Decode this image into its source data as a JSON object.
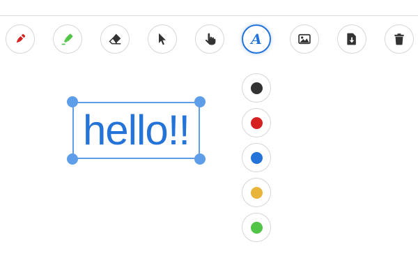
{
  "colors": {
    "accent": "#2473d8",
    "selection": "#5e9ee8",
    "icon_dark": "#333333",
    "pen_red": "#d62121",
    "highlighter_green": "#52c447"
  },
  "toolbar": {
    "tools": [
      {
        "name": "pen-tool-button",
        "icon": "pen-icon",
        "active": false
      },
      {
        "name": "highlighter-tool-button",
        "icon": "highlighter-icon",
        "active": false
      },
      {
        "name": "eraser-tool-button",
        "icon": "eraser-icon",
        "active": false
      },
      {
        "name": "select-tool-button",
        "icon": "cursor-arrow-icon",
        "active": false
      },
      {
        "name": "pan-tool-button",
        "icon": "hand-pointer-icon",
        "active": false
      },
      {
        "name": "text-tool-button",
        "icon": "text-a-icon",
        "active": true,
        "glyph": "A"
      },
      {
        "name": "image-tool-button",
        "icon": "image-icon",
        "active": false
      },
      {
        "name": "download-button",
        "icon": "file-download-icon",
        "active": false
      },
      {
        "name": "delete-button",
        "icon": "trash-icon",
        "active": false
      }
    ]
  },
  "palette": {
    "swatches": [
      {
        "name": "color-swatch-black",
        "color": "#333333"
      },
      {
        "name": "color-swatch-red",
        "color": "#d62121"
      },
      {
        "name": "color-swatch-blue",
        "color": "#2473d8"
      },
      {
        "name": "color-swatch-yellow",
        "color": "#e8b53a"
      },
      {
        "name": "color-swatch-green",
        "color": "#52c447"
      }
    ]
  },
  "canvas": {
    "text_object": {
      "text": "hello!!",
      "color": "#2473d8"
    }
  }
}
